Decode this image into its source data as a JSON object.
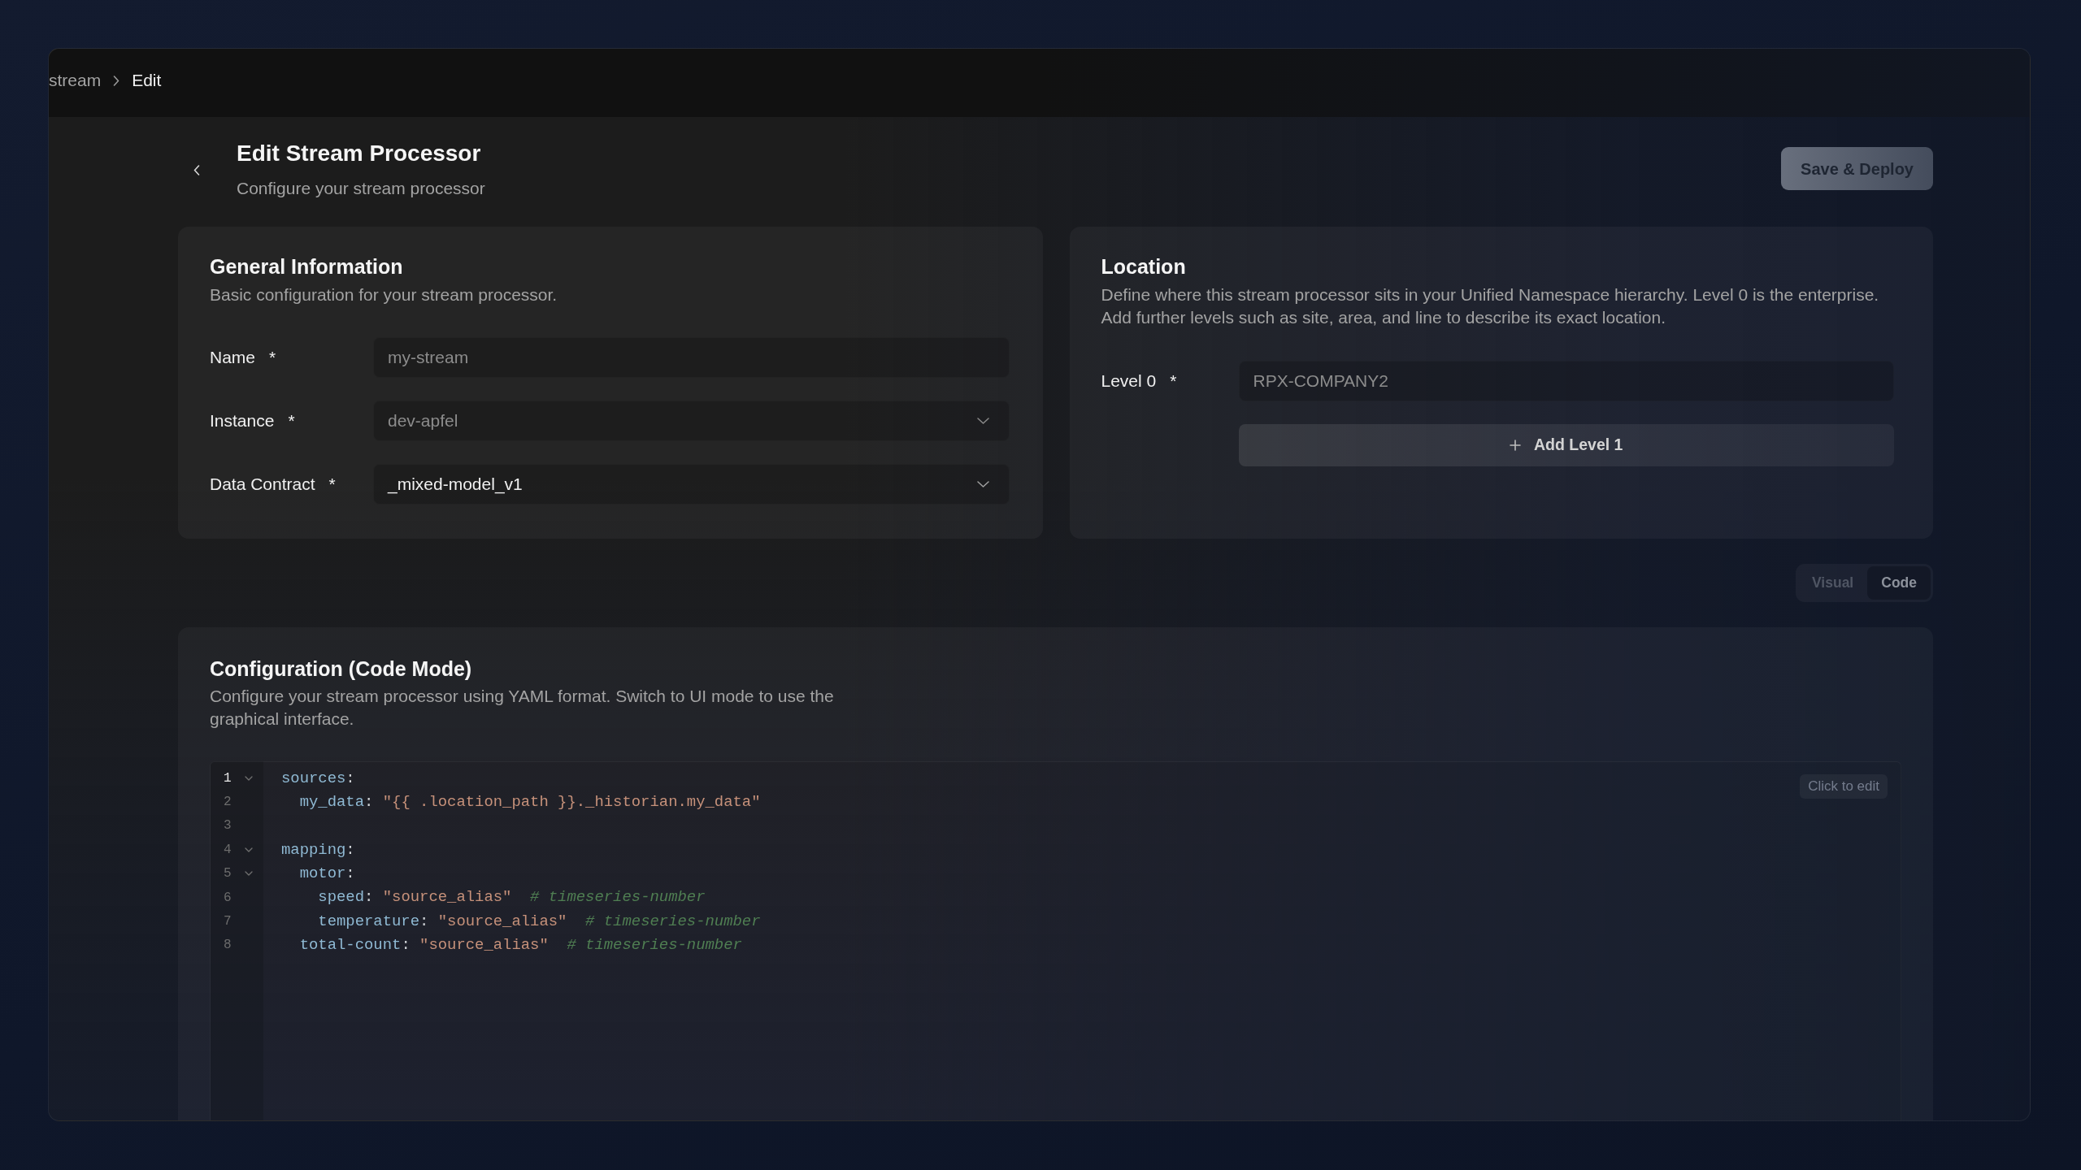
{
  "breadcrumb": [
    {
      "label": "stream",
      "current": false
    },
    {
      "label": "Edit",
      "current": true
    }
  ],
  "header": {
    "title": "Edit Stream Processor",
    "subtitle": "Configure your stream processor",
    "primary_button": "Save & Deploy"
  },
  "general_information": {
    "title": "General Information",
    "description": "Basic configuration for your stream processor.",
    "fields": [
      {
        "label": "Name",
        "required_mark": "*",
        "kind": "text",
        "value": "my-stream",
        "disabled": true
      },
      {
        "label": "Instance",
        "required_mark": "*",
        "kind": "select",
        "value": "dev-apfel",
        "disabled": true
      },
      {
        "label": "Data Contract",
        "required_mark": "*",
        "kind": "select",
        "value": "_mixed-model_v1",
        "disabled": false
      }
    ]
  },
  "location": {
    "title": "Location",
    "description": "Define where this stream processor sits in your Unified Namespace hierarchy. Level 0 is the enterprise. Add further levels such as site, area, and line to describe its exact location.",
    "levels": [
      {
        "label": "Level 0",
        "required_mark": "*",
        "value": "RPX-COMPANY2",
        "disabled": true
      }
    ],
    "add_button": "Add Level 1"
  },
  "view_toggle": [
    {
      "label": "Visual",
      "selected": false
    },
    {
      "label": "Code",
      "selected": true
    }
  ],
  "configuration": {
    "title": "Configuration (Code Mode)",
    "description": "Configure your stream processor using YAML format. Switch to UI mode to use the graphical interface.",
    "editor": {
      "edit_button": "Click to edit",
      "lines": [
        {
          "number": "1",
          "active": true,
          "expanded": true,
          "tokens": [
            {
              "kind": "key",
              "text": "sources"
            },
            {
              "kind": "punct",
              "text": ":"
            }
          ],
          "children": [
            {
              "number": "2",
              "active": false,
              "tokens": [
                {
                  "kind": "key",
                  "text": "my_data"
                },
                {
                  "kind": "punct",
                  "text": ":"
                },
                {
                  "kind": "string",
                  "text": "\"{{ .location_path }}._historian.my_data\""
                }
              ]
            }
          ]
        },
        {
          "number": "3",
          "active": false
        },
        {
          "number": "4",
          "active": false,
          "expanded": true,
          "tokens": [
            {
              "kind": "key",
              "text": "mapping"
            },
            {
              "kind": "punct",
              "text": ":"
            }
          ],
          "children": [
            {
              "number": "5",
              "active": false,
              "expanded": true,
              "tokens": [
                {
                  "kind": "key",
                  "text": "motor"
                },
                {
                  "kind": "punct",
                  "text": ":"
                }
              ],
              "children": [
                {
                  "number": "6",
                  "active": false,
                  "tokens": [
                    {
                      "kind": "key",
                      "text": "speed"
                    },
                    {
                      "kind": "punct",
                      "text": ":"
                    },
                    {
                      "kind": "string",
                      "text": "\"source_alias\""
                    },
                    {
                      "kind": "comment",
                      "text": "# timeseries-number"
                    }
                  ]
                },
                {
                  "number": "7",
                  "active": false,
                  "tokens": [
                    {
                      "kind": "key",
                      "text": "temperature"
                    },
                    {
                      "kind": "punct",
                      "text": ":"
                    },
                    {
                      "kind": "string",
                      "text": "\"source_alias\""
                    },
                    {
                      "kind": "comment",
                      "text": "# timeseries-number"
                    }
                  ]
                }
              ]
            },
            {
              "number": "8",
              "active": false,
              "tokens": [
                {
                  "kind": "key",
                  "text": "total-count"
                },
                {
                  "kind": "punct",
                  "text": ":"
                },
                {
                  "kind": "string",
                  "text": "\"source_alias\""
                },
                {
                  "kind": "comment",
                  "text": "# timeseries-number"
                }
              ]
            }
          ]
        }
      ]
    }
  }
}
